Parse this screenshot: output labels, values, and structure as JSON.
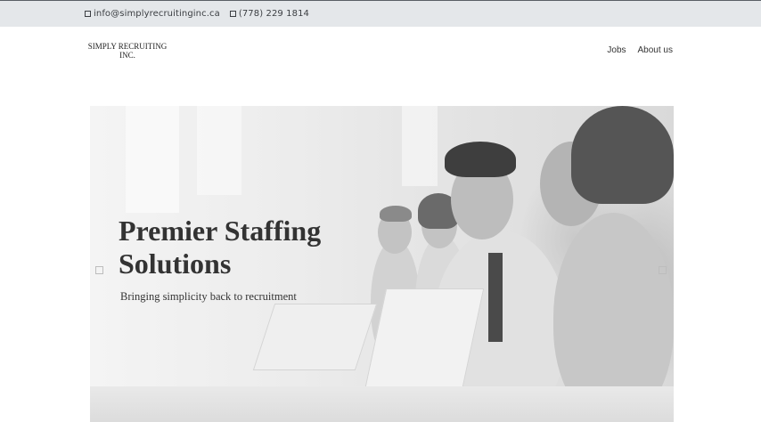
{
  "topbar": {
    "email": "info@simplyrecruitinginc.ca",
    "email_icon": "square-icon",
    "phone": "(778) 229 1814",
    "phone_icon": "square-icon"
  },
  "header": {
    "logo_text": "SIMPLY RECRUITING INC.",
    "nav": [
      {
        "label": "Jobs"
      },
      {
        "label": "About us"
      }
    ]
  },
  "hero": {
    "title": "Premier Staffing Solutions",
    "subtitle": "Bringing simplicity back to recruitment",
    "image": "office-team-meeting-photo",
    "prev_icon": "square-icon",
    "next_icon": "square-icon"
  }
}
